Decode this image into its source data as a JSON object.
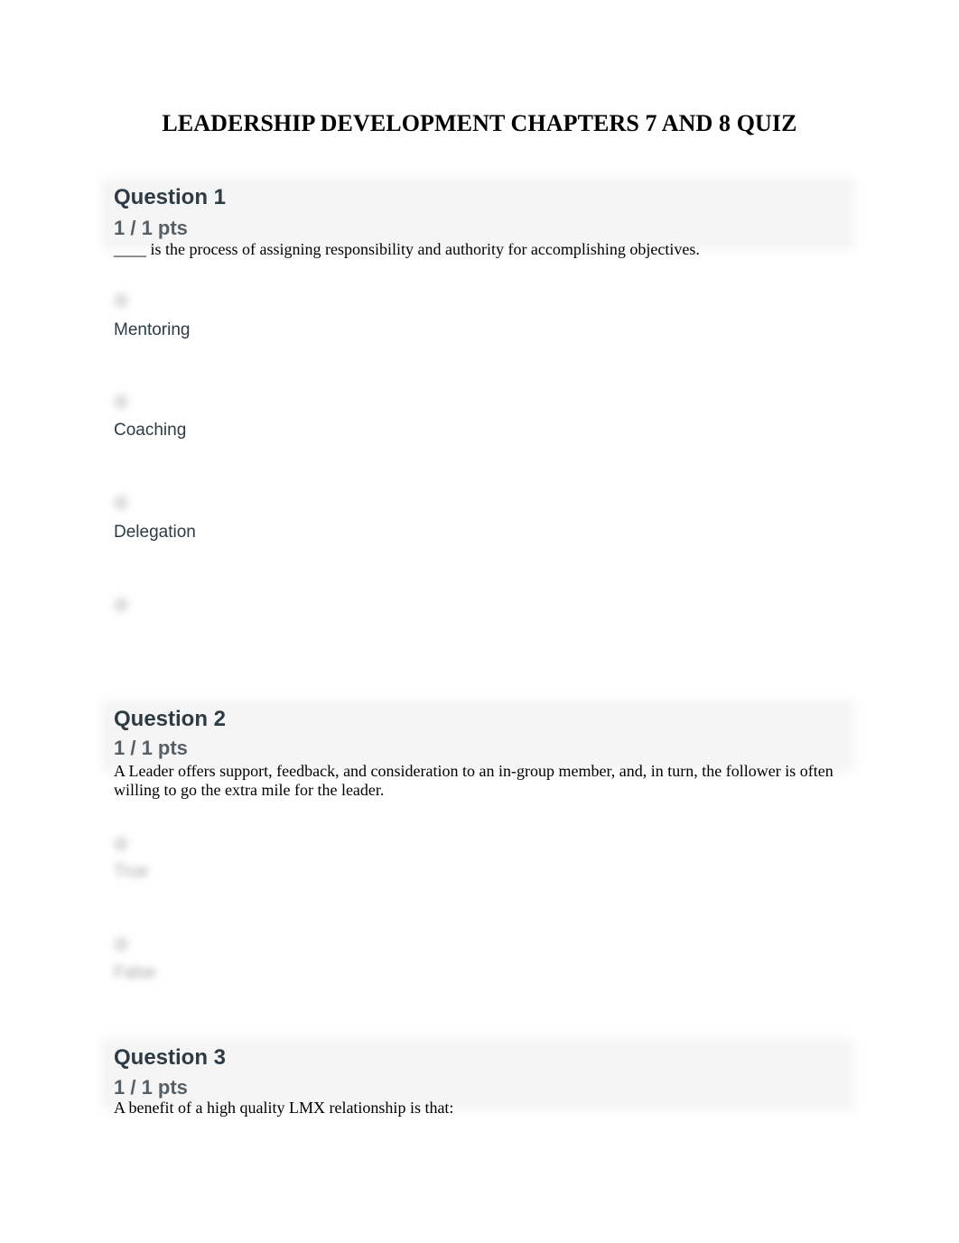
{
  "document": {
    "title": "LEADERSHIP DEVELOPMENT CHAPTERS 7 AND 8 QUIZ"
  },
  "questions": [
    {
      "title": "Question 1",
      "points": "1 / 1 pts",
      "text": "____ is the process of assigning responsibility and authority for accomplishing objectives.",
      "answers": [
        {
          "label": "Mentoring",
          "icon": "radio-icon"
        },
        {
          "label": "Coaching",
          "icon": "radio-icon"
        },
        {
          "label": "Delegation",
          "icon": "radio-icon"
        },
        {
          "label": "",
          "icon": "radio-icon"
        }
      ]
    },
    {
      "title": "Question 2",
      "points": "1 / 1 pts",
      "text": "A Leader offers support, feedback, and consideration to an in-group member, and, in turn, the follower is often willing to go the extra mile for the leader.",
      "answers": [
        {
          "label": "True",
          "icon": "radio-icon",
          "blurred": true
        },
        {
          "label": "False",
          "icon": "radio-icon",
          "blurred": true
        }
      ]
    },
    {
      "title": "Question 3",
      "points": "1 / 1 pts",
      "text": "A benefit of a high quality LMX relationship is that:"
    }
  ]
}
